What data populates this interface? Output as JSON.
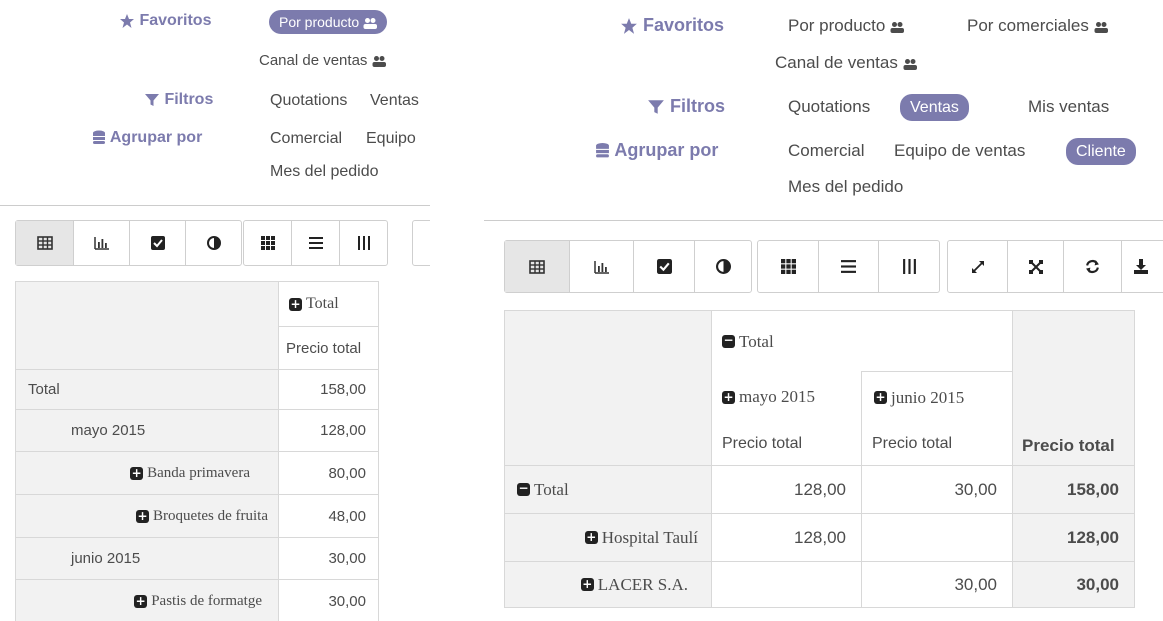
{
  "left": {
    "favoritos_label": "Favoritos",
    "favoritos_items": [
      "Por producto",
      "Canal de ventas"
    ],
    "filtros_label": "Filtros",
    "filtros_items": [
      "Quotations",
      "Ventas"
    ],
    "agrupar_label": "Agrupar por",
    "agrupar_items": [
      "Comercial",
      "Equipo",
      "Mes del pedido"
    ],
    "table": {
      "total_header": "Total",
      "measure_header": "Precio total",
      "rows": [
        {
          "label": "Total",
          "value": "158,00"
        },
        {
          "label": "mayo 2015",
          "value": "128,00"
        },
        {
          "label": "Banda primavera",
          "value": "80,00"
        },
        {
          "label": "Broquetes de fruita",
          "value": "48,00"
        },
        {
          "label": "junio 2015",
          "value": "30,00"
        },
        {
          "label": "Pastis de formatge",
          "value": "30,00"
        }
      ]
    }
  },
  "right": {
    "favoritos_label": "Favoritos",
    "favoritos_items": [
      "Por producto",
      "Por comerciales",
      "Canal de ventas"
    ],
    "filtros_label": "Filtros",
    "filtros_items": [
      "Quotations",
      "Ventas",
      "Mis ventas"
    ],
    "agrupar_label": "Agrupar por",
    "agrupar_items": [
      "Comercial",
      "Equipo de ventas",
      "Cliente",
      "Mes del pedido"
    ],
    "table": {
      "total_header": "Total",
      "col_mayo": "mayo 2015",
      "col_junio": "junio 2015",
      "measure": "Precio total",
      "rows": [
        {
          "label": "Total",
          "mayo": "128,00",
          "junio": "30,00",
          "total": "158,00"
        },
        {
          "label": "Hospital Taulí",
          "mayo": "128,00",
          "junio": "",
          "total": "128,00"
        },
        {
          "label": "LACER S.A.",
          "mayo": "",
          "junio": "30,00",
          "total": "30,00"
        }
      ]
    }
  },
  "icons": {
    "star": "star-icon",
    "filter": "filter-icon",
    "database": "database-icon",
    "users": "users-icon",
    "table": "table-view-icon",
    "bar_chart": "bar-chart-icon",
    "check": "checkbox-icon",
    "pie": "pie-chart-icon",
    "grid": "grid-icon",
    "list": "list-icon",
    "columns": "columns-icon",
    "expand": "expand-icon",
    "compress": "collapse-all-icon",
    "refresh": "refresh-icon",
    "download": "download-icon",
    "plus": "expand-plus-icon",
    "minus": "collapse-minus-icon"
  },
  "colors": {
    "accent": "#7c7bad",
    "header_bg": "#f2f2f2",
    "border": "#d8d8d8"
  }
}
